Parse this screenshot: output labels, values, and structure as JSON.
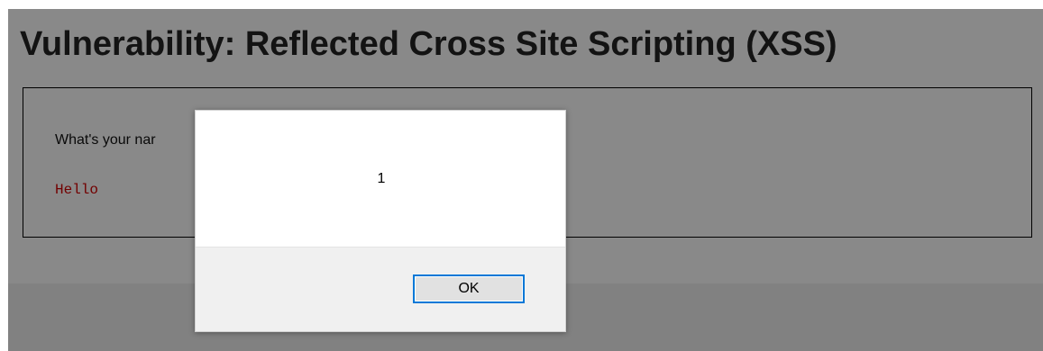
{
  "page": {
    "title": "Vulnerability: Reflected Cross Site Scripting (XSS)",
    "name_prompt": "What's your nar",
    "greeting": "Hello"
  },
  "alert": {
    "message": "1",
    "ok_label": "OK"
  },
  "colors": {
    "greeting_text": "#cc0000",
    "button_focus_border": "#0078d7"
  }
}
